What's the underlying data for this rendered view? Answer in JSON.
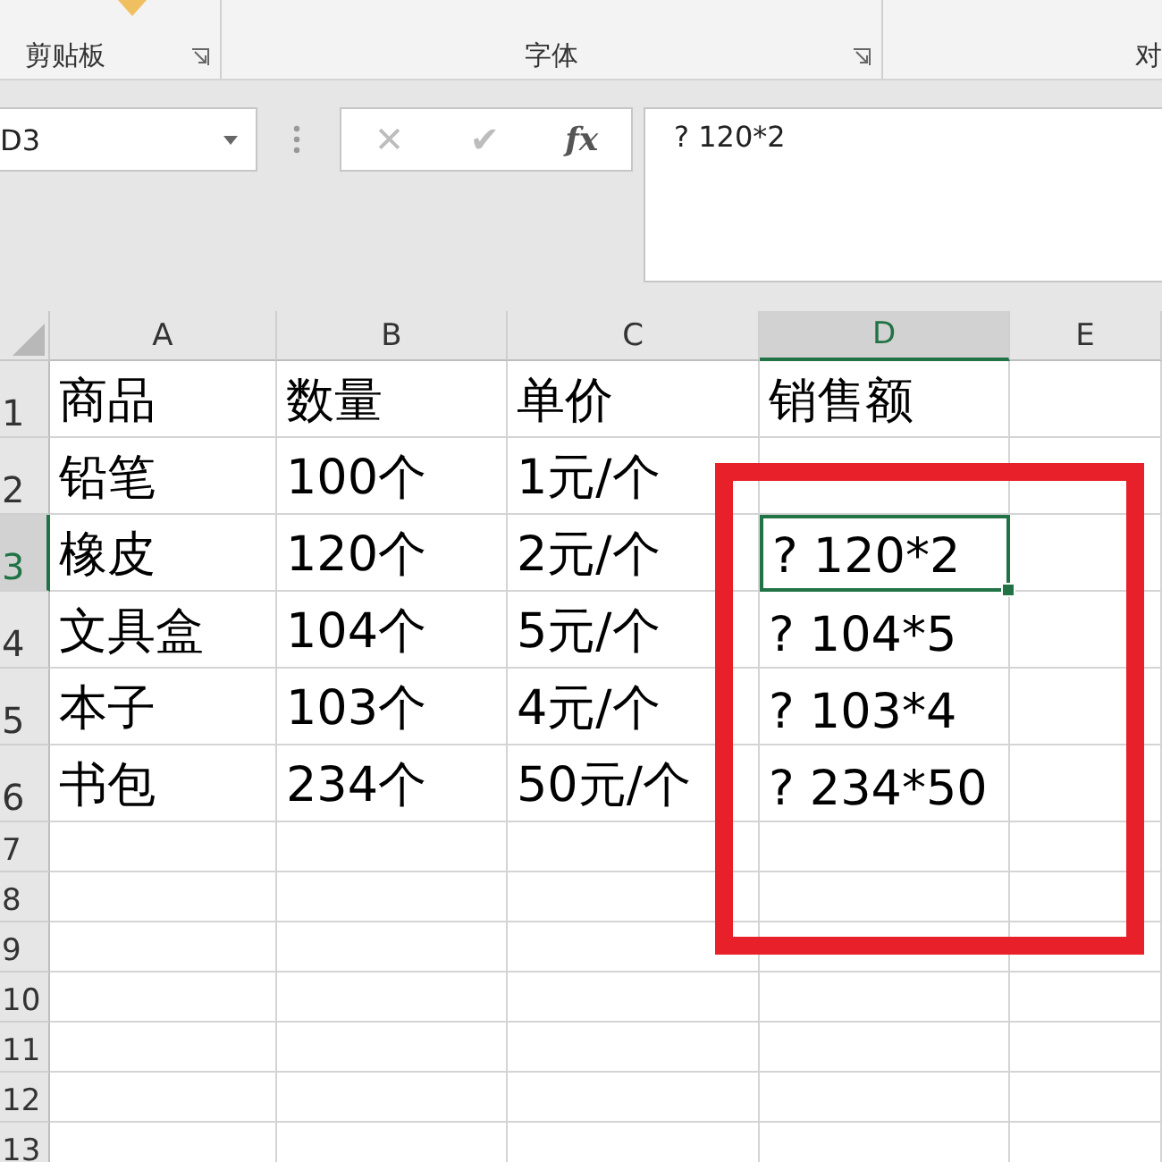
{
  "ribbon": {
    "groups": [
      {
        "label": "剪贴板",
        "launcher": true
      },
      {
        "label": "字体",
        "launcher": true
      },
      {
        "label": "对",
        "launcher": false
      }
    ]
  },
  "formula_bar": {
    "name_box": "D3",
    "cancel": "✕",
    "enter": "✔",
    "fx": "fx",
    "value": "? 120*2"
  },
  "sheet": {
    "columns": [
      {
        "label": "A",
        "selected": false
      },
      {
        "label": "B",
        "selected": false
      },
      {
        "label": "C",
        "selected": false
      },
      {
        "label": "D",
        "selected": true
      },
      {
        "label": "E",
        "selected": false
      }
    ],
    "rows": [
      {
        "label": "1",
        "selected": false,
        "cells": [
          "商品",
          "数量",
          "单价",
          "销售额",
          ""
        ]
      },
      {
        "label": "2",
        "selected": false,
        "cells": [
          "铅笔",
          "100个",
          "1元/个",
          "",
          ""
        ]
      },
      {
        "label": "3",
        "selected": true,
        "cells": [
          "橡皮",
          "120个",
          "2元/个",
          "? 120*2",
          ""
        ]
      },
      {
        "label": "4",
        "selected": false,
        "cells": [
          "文具盒",
          "104个",
          "5元/个",
          "? 104*5",
          ""
        ]
      },
      {
        "label": "5",
        "selected": false,
        "cells": [
          "本子",
          "103个",
          "4元/个",
          "? 103*4",
          ""
        ]
      },
      {
        "label": "6",
        "selected": false,
        "cells": [
          "书包",
          "234个",
          "50元/个",
          "? 234*50",
          ""
        ]
      },
      {
        "label": "7",
        "selected": false,
        "cells": [
          "",
          "",
          "",
          "",
          ""
        ]
      },
      {
        "label": "8",
        "selected": false,
        "cells": [
          "",
          "",
          "",
          "",
          ""
        ]
      },
      {
        "label": "9",
        "selected": false,
        "cells": [
          "",
          "",
          "",
          "",
          ""
        ]
      },
      {
        "label": "10",
        "selected": false,
        "cells": [
          "",
          "",
          "",
          "",
          ""
        ]
      },
      {
        "label": "11",
        "selected": false,
        "cells": [
          "",
          "",
          "",
          "",
          ""
        ]
      },
      {
        "label": "12",
        "selected": false,
        "cells": [
          "",
          "",
          "",
          "",
          ""
        ]
      },
      {
        "label": "13",
        "selected": false,
        "cells": [
          "",
          "",
          "",
          "",
          ""
        ]
      }
    ]
  },
  "annotation": {
    "kind": "red-frame",
    "color": "#e8202a"
  }
}
